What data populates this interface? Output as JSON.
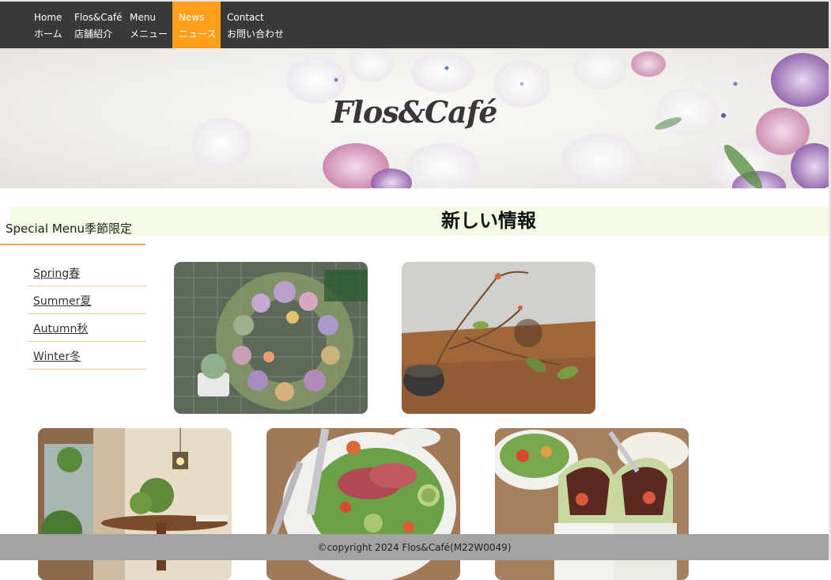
{
  "nav": {
    "items": [
      {
        "en": "Home",
        "jp": "ホーム",
        "active": false
      },
      {
        "en": "Flos&Café",
        "jp": "店舗紹介",
        "active": false
      },
      {
        "en": "Menu",
        "jp": "メニュー",
        "active": false
      },
      {
        "en": "News",
        "jp": "ニュース",
        "active": true
      },
      {
        "en": "Contact",
        "jp": "お問い合わせ",
        "active": false
      }
    ]
  },
  "hero": {
    "title": "Flos&Café"
  },
  "main": {
    "heading": "新しい情報"
  },
  "sidebar": {
    "title": "Special Menu季節限定",
    "items": [
      {
        "label": "Spring春"
      },
      {
        "label": "Summer夏"
      },
      {
        "label": "Autumn秋"
      },
      {
        "label": "Winter冬"
      }
    ]
  },
  "gallery": {
    "photos": [
      {
        "subject": "succulent-wreath"
      },
      {
        "subject": "branch-vase"
      },
      {
        "subject": "cafe-interior"
      },
      {
        "subject": "salad-plate"
      },
      {
        "subject": "wrap-sandwich"
      }
    ]
  },
  "footer": {
    "copyright": "©copyright 2024 Flos&Café(M22W0049)"
  },
  "colors": {
    "nav_bg": "#3b383b",
    "nav_active": "#ff9f1a",
    "band_bg": "#f2fbe4",
    "accent_line": "#f5a84a",
    "footer_bg": "#a3a3a3"
  }
}
